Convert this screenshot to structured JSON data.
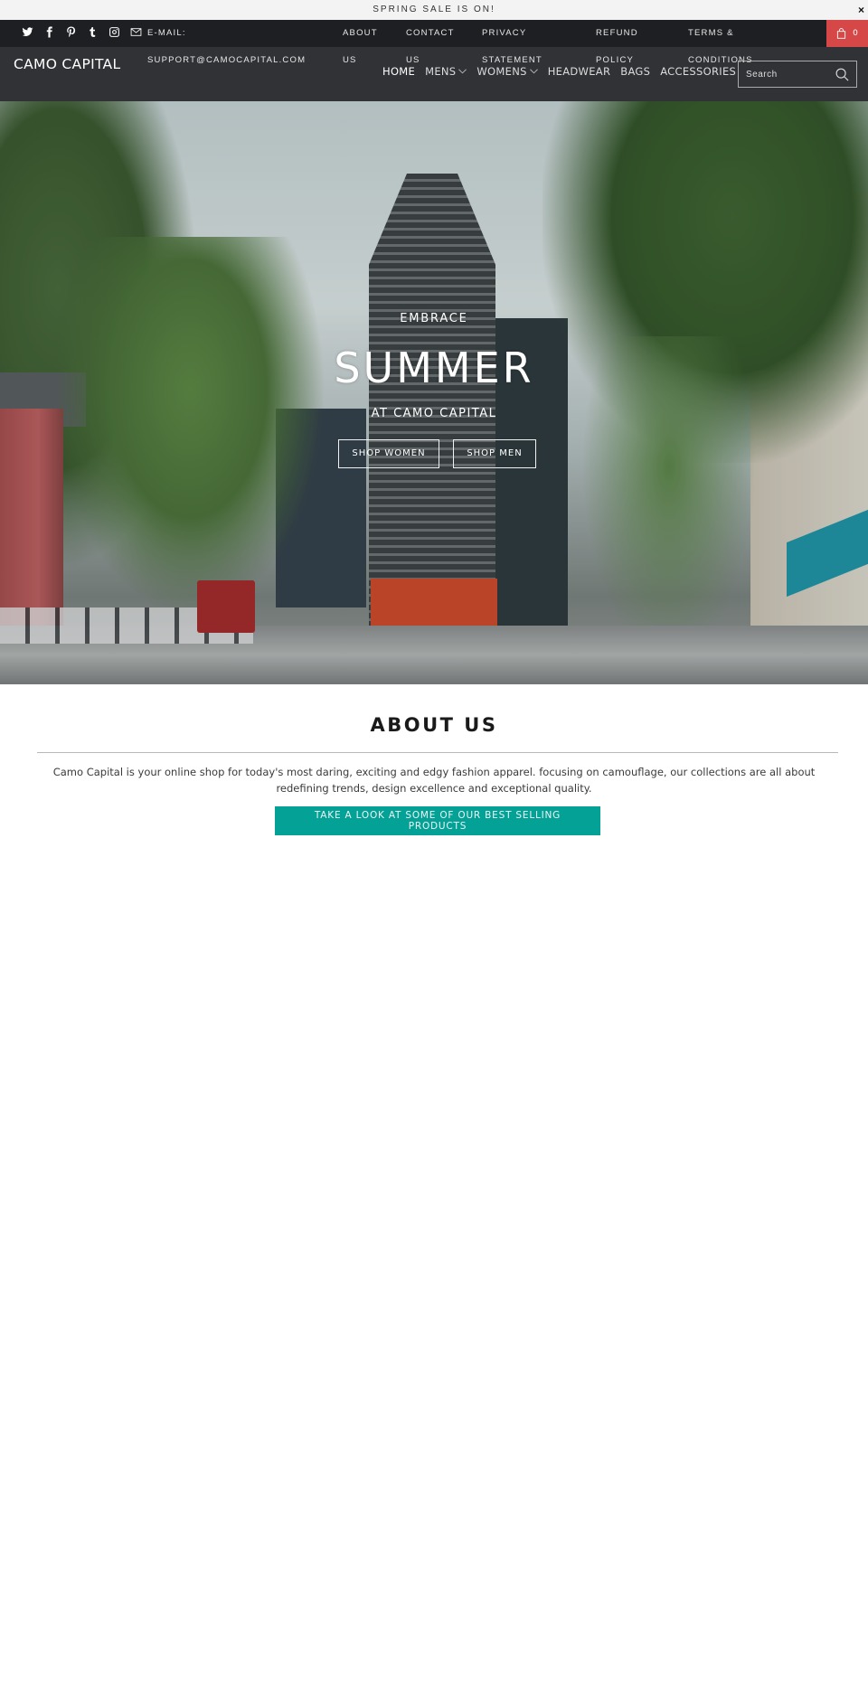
{
  "announcement": {
    "text": "SPRING SALE IS ON!",
    "close_label": "×"
  },
  "topbar": {
    "social_icons": [
      "twitter-icon",
      "facebook-icon",
      "pinterest-icon",
      "tumblr-icon",
      "instagram-icon",
      "email-icon"
    ],
    "email_label": "E-MAIL:",
    "email_value": "SUPPORT@CAMOCAPITAL.COM",
    "links": [
      {
        "line1": "ABOUT",
        "line2": "US"
      },
      {
        "line1": "CONTACT",
        "line2": "US"
      },
      {
        "line1": "PRIVACY",
        "line2": "STATEMENT"
      },
      {
        "line1": "REFUND",
        "line2": "POLICY"
      },
      {
        "line1": "TERMS &",
        "line2": "CONDITIONS"
      }
    ],
    "cart_count": "0"
  },
  "header": {
    "logo": "CAMO CAPITAL",
    "nav": [
      {
        "label": "HOME",
        "dropdown": false,
        "active": true
      },
      {
        "label": "MENS",
        "dropdown": true
      },
      {
        "label": "WOMENS",
        "dropdown": true
      },
      {
        "label": "HEADWEAR",
        "dropdown": false
      },
      {
        "label": "BAGS",
        "dropdown": false
      },
      {
        "label": "ACCESSORIES",
        "dropdown": false
      }
    ],
    "search": {
      "placeholder": "Search",
      "value": ""
    }
  },
  "hero": {
    "pretitle": "EMBRACE",
    "title": "SUMMER",
    "subtitle": "AT CAMO CAPITAL",
    "buttons": [
      {
        "label": "SHOP WOMEN"
      },
      {
        "label": "SHOP MEN"
      }
    ]
  },
  "about": {
    "title": "ABOUT US",
    "text": "Camo Capital is your online shop for today's most daring, exciting and edgy fashion apparel. focusing on camouflage, our collections are all about redefining trends, design excellence and exceptional quality.",
    "cta_label": "TAKE A LOOK AT SOME OF OUR BEST SELLING PRODUCTS"
  },
  "colors": {
    "topbar_bg": "#1e1f22",
    "header_bg": "#303236",
    "cart_bg": "#d64848",
    "cta_bg": "#04a296",
    "announce_bg": "#f3f3f3"
  }
}
